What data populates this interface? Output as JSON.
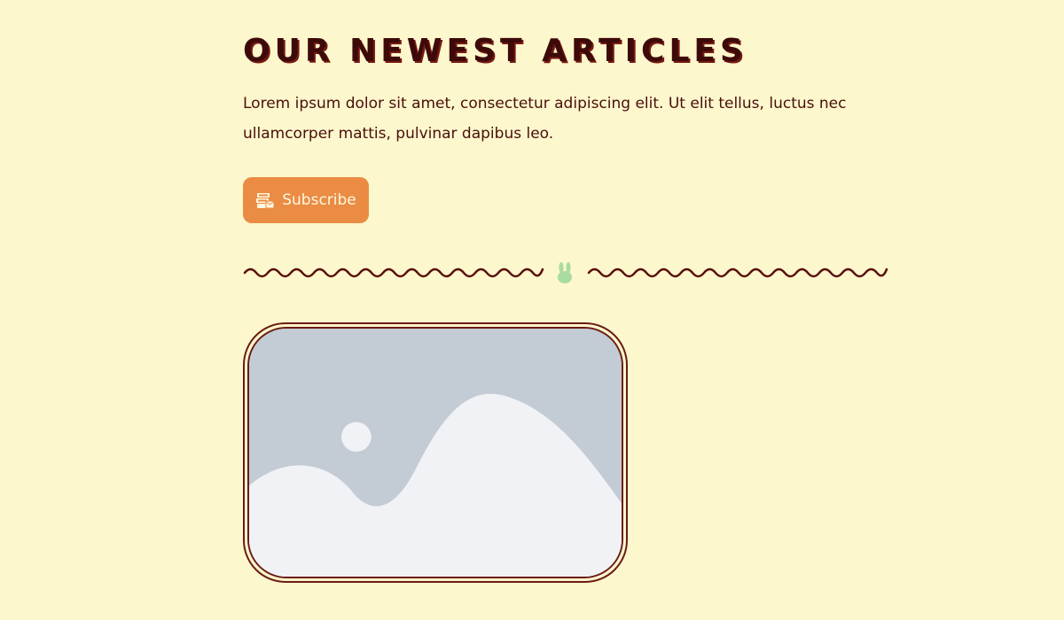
{
  "section": {
    "title": "OUR NEWEST ARTICLES",
    "intro": "Lorem ipsum dolor sit amet, consectetur adipiscing elit. Ut elit tellus, luctus nec ullamcorper mattis, pulvinar dapibus leo."
  },
  "subscribe_button": {
    "label": "Subscribe",
    "icon": "newsletter-stack-icon"
  },
  "divider": {
    "icon": "bunny-icon",
    "line_color": "#5a0f0a",
    "icon_color": "#a8dca0"
  },
  "article_image": {
    "icon": "image-placeholder-icon"
  },
  "colors": {
    "background": "#fcf7cd",
    "text": "#4a0f0c",
    "accent": "#ea8c44",
    "border": "#6b1b15"
  }
}
